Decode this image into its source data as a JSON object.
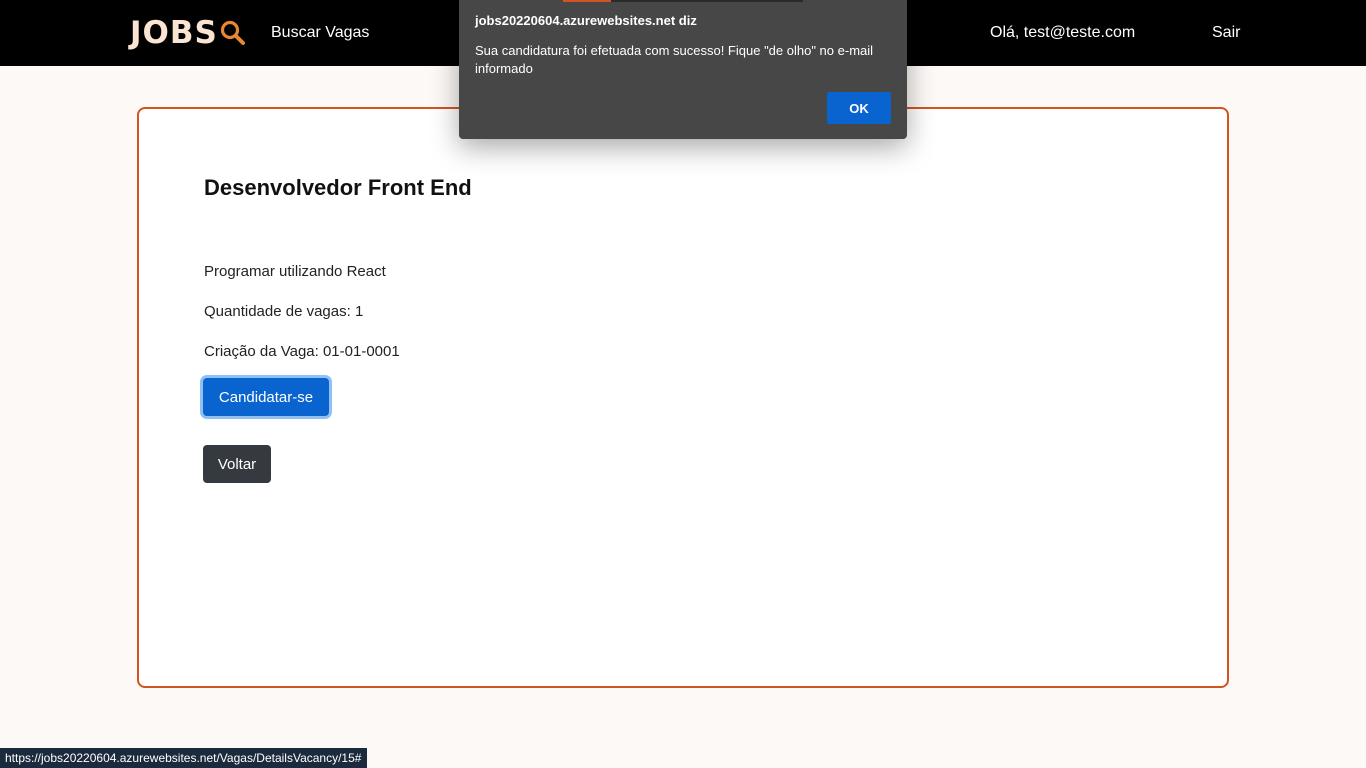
{
  "navbar": {
    "logo_text": "JOBS",
    "search_link": "Buscar Vagas",
    "greeting": "Olá, test@teste.com",
    "logout": "Sair",
    "accent_color": "#d4541f"
  },
  "job": {
    "title": "Desenvolvedor Front End",
    "description": "Programar utilizando React",
    "quantity": "Quantidade de vagas: 1",
    "created": "Criação da Vaga: 01-01-0001",
    "apply_button": "Candidatar-se",
    "back_button": "Voltar"
  },
  "dialog": {
    "title": "jobs20220604.azurewebsites.net diz",
    "message": "Sua candidatura foi efetuada com sucesso! Fique \"de olho\" no e-mail informado",
    "ok_button": "OK"
  },
  "status_bar": {
    "url": "https://jobs20220604.azurewebsites.net/Vagas/DetailsVacancy/15#"
  }
}
